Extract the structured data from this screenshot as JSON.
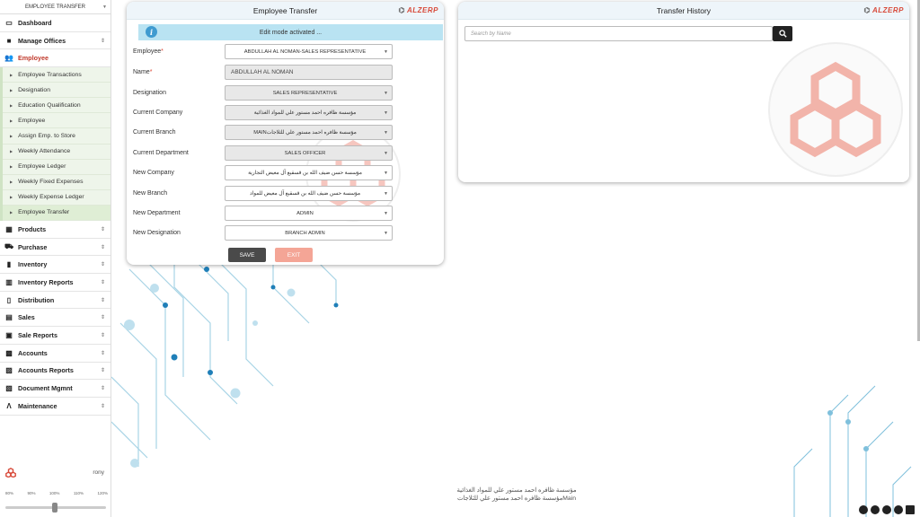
{
  "sidebar": {
    "top_title": "EMPLOYEE TRANSFER",
    "menu_before": [
      {
        "label": "Dashboard",
        "icon": "monitor-icon",
        "glyph": "▭",
        "has_toggle": false
      },
      {
        "label": "Manage Offices",
        "icon": "briefcase-icon",
        "glyph": "■",
        "has_toggle": true
      }
    ],
    "active_menu": {
      "label": "Employee",
      "icon": "users-icon",
      "glyph": "👥"
    },
    "submenu": [
      "Employee Transactions",
      "Designation",
      "Education Qualification",
      "Employee",
      "Assign Emp. to Store",
      "Weekly Attendance",
      "Employee Ledger",
      "Weekly Fixed Expenses",
      "Weekly Expense Ledger",
      "Employee Transfer"
    ],
    "menu_after": [
      {
        "label": "Products",
        "icon": "grid-icon",
        "glyph": "▦"
      },
      {
        "label": "Purchase",
        "icon": "cart-icon",
        "glyph": "⛟"
      },
      {
        "label": "Inventory",
        "icon": "boxes-icon",
        "glyph": "▮"
      },
      {
        "label": "Inventory Reports",
        "icon": "bar-chart-icon",
        "glyph": "▥"
      },
      {
        "label": "Distribution",
        "icon": "book-icon",
        "glyph": "▯"
      },
      {
        "label": "Sales",
        "icon": "register-icon",
        "glyph": "▤"
      },
      {
        "label": "Sale Reports",
        "icon": "report-icon",
        "glyph": "▣"
      },
      {
        "label": "Accounts",
        "icon": "calculator-icon",
        "glyph": "▩"
      },
      {
        "label": "Accounts Reports",
        "icon": "ledger-icon",
        "glyph": "▨"
      },
      {
        "label": "Document Mgmnt",
        "icon": "folder-icon",
        "glyph": "▧"
      },
      {
        "label": "Maintenance",
        "icon": "compass-icon",
        "glyph": "Λ"
      }
    ],
    "user_name": "rony",
    "zoom_levels": [
      "80%",
      "90%",
      "100%",
      "110%",
      "120%"
    ],
    "zoom_selected": "100%"
  },
  "transfer_panel": {
    "title": "Employee Transfer",
    "brand": "ALZERP",
    "edit_message": "Edit mode activated ...",
    "fields": [
      {
        "label": "Employee",
        "required": true,
        "value": "ABDULLAH AL NOMAN-SALES REPRESENTATIVE",
        "kind": "select",
        "grey": false
      },
      {
        "label": "Name",
        "required": true,
        "value": "ABDULLAH AL NOMAN",
        "kind": "text",
        "grey": true
      },
      {
        "label": "Designation",
        "required": false,
        "value": "SALES REPRESENTATIVE",
        "kind": "select",
        "grey": true
      },
      {
        "label": "Current Company",
        "required": false,
        "value": "مؤسسة ظافره احمد مستور علي للمواد الغذائية",
        "kind": "select",
        "grey": true
      },
      {
        "label": "Current Branch",
        "required": false,
        "value": "MAINمؤسسة ظافره احمد مستور علي للثلاجات",
        "kind": "select",
        "grey": true
      },
      {
        "label": "Current Department",
        "required": false,
        "value": "SALES OFFICER",
        "kind": "select",
        "grey": true
      },
      {
        "label": "New Company",
        "required": false,
        "value": "مؤسسة حسن ضيف الله بن قسقيع آل معيض التجارية",
        "kind": "select",
        "grey": false
      },
      {
        "label": "New Branch",
        "required": false,
        "value": "مؤسسة حسن ضيف الله بن قسقيع آل معيض للمواد",
        "kind": "select",
        "grey": false
      },
      {
        "label": "New Department",
        "required": false,
        "value": "ADMIN",
        "kind": "select",
        "grey": false
      },
      {
        "label": "New Designation",
        "required": false,
        "value": "BRANCH ADMIN",
        "kind": "select",
        "grey": false
      }
    ],
    "save_label": "SAVE",
    "exit_label": "EXIT"
  },
  "history_panel": {
    "title": "Transfer History",
    "brand": "ALZERP",
    "search_placeholder": "Search by Name"
  },
  "footer": {
    "company_line1": "مؤسسة ظافره احمد مستور علي للمواد الغذائية",
    "company_line2": "Mainمؤسسة ظافره احمد مستور علي للثلاجات"
  },
  "colors": {
    "accent_red": "#d84a3a",
    "header_bg": "#eef5fa",
    "info_bar": "#b9e3f2",
    "circuit": "#1f7fb8"
  }
}
